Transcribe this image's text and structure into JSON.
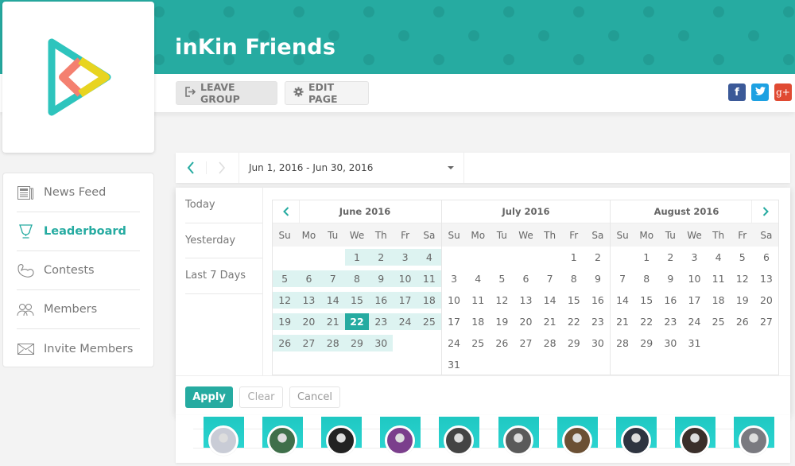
{
  "header": {
    "group_name": "inKin Friends",
    "banner_color": "#26aba1",
    "leave_group_label": "LEAVE GROUP",
    "edit_page_label": "EDIT PAGE",
    "social": [
      {
        "name": "facebook",
        "glyph": "f",
        "color": "#3b5998"
      },
      {
        "name": "twitter",
        "glyph": "t",
        "color": "#1da1e2"
      },
      {
        "name": "google-plus",
        "glyph": "g+",
        "color": "#e04a32"
      }
    ]
  },
  "sidebar": {
    "items": [
      {
        "label": "News Feed",
        "icon": "newspaper-icon",
        "active": false
      },
      {
        "label": "Leaderboard",
        "icon": "trophy-icon",
        "active": true
      },
      {
        "label": "Contests",
        "icon": "flexed-arm-icon",
        "active": false
      },
      {
        "label": "Members",
        "icon": "group-icon",
        "active": false
      },
      {
        "label": "Invite Members",
        "icon": "envelope-icon",
        "active": false
      }
    ]
  },
  "date_range": {
    "value": "Jun 1, 2016 - Jun 30, 2016"
  },
  "picker": {
    "ranges": [
      "Today",
      "Yesterday",
      "Last 7 Days"
    ],
    "weekdays": [
      "Su",
      "Mo",
      "Tu",
      "We",
      "Th",
      "Fr",
      "Sa"
    ],
    "months": [
      {
        "title": "June 2016",
        "offset": 3,
        "days": 30,
        "range_start": 1,
        "range_end": 30,
        "selected": 22
      },
      {
        "title": "July 2016",
        "offset": 5,
        "days": 31,
        "range_start": null,
        "range_end": null,
        "selected": null
      },
      {
        "title": "August 2016",
        "offset": 1,
        "days": 31,
        "range_start": null,
        "range_end": null,
        "selected": null
      }
    ],
    "apply_label": "Apply",
    "clear_label": "Clear",
    "cancel_label": "Cancel",
    "accent": "#26aba1",
    "range_color": "#ddf3f1"
  },
  "leaderboard": {
    "avatars": [
      {
        "name": "member-1",
        "color": "#c9ccd6"
      },
      {
        "name": "member-2",
        "color": "#3f6f4a"
      },
      {
        "name": "member-3",
        "color": "#222222"
      },
      {
        "name": "member-4",
        "color": "#7b3f8c"
      },
      {
        "name": "member-5",
        "color": "#444444"
      },
      {
        "name": "member-6",
        "color": "#5a5a5a"
      },
      {
        "name": "member-7",
        "color": "#6b5034"
      },
      {
        "name": "member-8",
        "color": "#2e3440"
      },
      {
        "name": "member-9",
        "color": "#3a2f2a"
      },
      {
        "name": "member-10",
        "color": "#7a7a80"
      }
    ]
  }
}
